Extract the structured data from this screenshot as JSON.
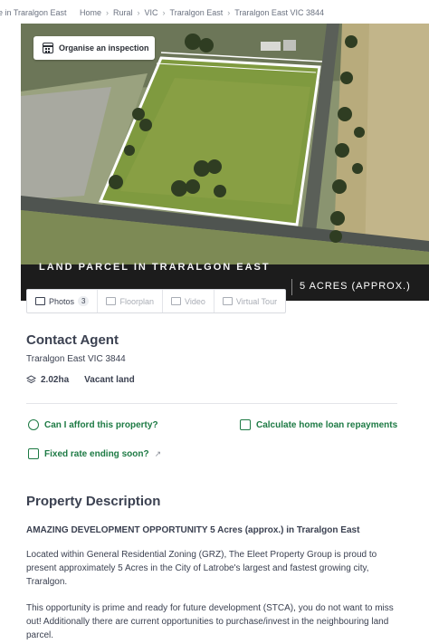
{
  "breadcrumbs": {
    "left_truncated": "e in Traralgon East",
    "items": [
      "Home",
      "Rural",
      "VIC",
      "Traralgon East",
      "Traralgon East VIC 3844"
    ]
  },
  "hero": {
    "inspection_button": "Organise an inspection",
    "banner_headline": "LAND PARCEL IN TRARALGON EAST",
    "banner_size": "5 ACRES (APPROX.)"
  },
  "media_tabs": [
    {
      "label": "Photos",
      "count": "3",
      "icon": "photo-icon"
    },
    {
      "label": "Floorplan",
      "icon": "floorplan-icon"
    },
    {
      "label": "Video",
      "icon": "video-icon"
    },
    {
      "label": "Virtual Tour",
      "icon": "virtual-tour-icon"
    }
  ],
  "contact": {
    "title": "Contact Agent",
    "address": "Traralgon East VIC 3844",
    "land_size": "2.02ha",
    "property_type": "Vacant land"
  },
  "finance_links": {
    "afford": "Can I afford this property?",
    "home_loan": "Calculate home loan repayments",
    "fixed_rate": "Fixed rate ending soon?"
  },
  "description": {
    "title": "Property Description",
    "lead": "AMAZING DEVELOPMENT OPPORTUNITY 5 Acres (approx.) in Traralgon East",
    "para1": "Located within General Residential Zoning (GRZ), The Eleet Property Group is proud to present approximately 5 Acres in the City of Latrobe's largest and fastest growing city, Traralgon.",
    "para2": "This opportunity is prime and ready for future development (STCA), you do not want to miss out! Additionally there are current opportunities to purchase/invest in the neighbouring land parcel."
  },
  "colors": {
    "accent_green": "#1d7a44",
    "text": "#3b4151",
    "banner": "#1c1c1c"
  }
}
